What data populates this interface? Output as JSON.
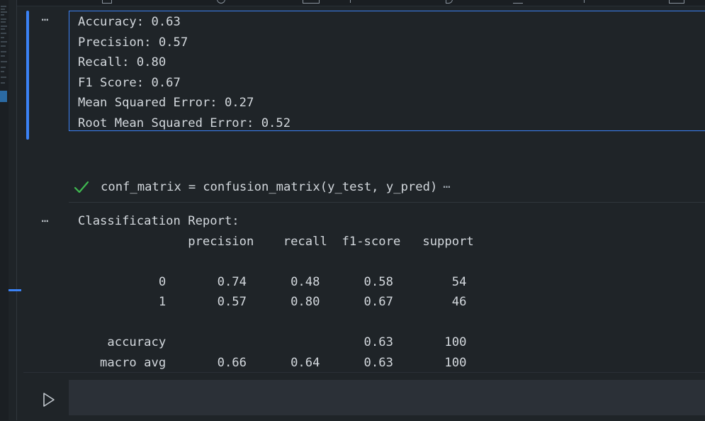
{
  "output_cell": {
    "metrics": [
      "Accuracy: 0.63",
      "Precision: 0.57",
      "Recall: 0.80",
      "F1 Score: 0.67",
      "Mean Squared Error: 0.27",
      "Root Mean Squared Error: 0.52"
    ],
    "text": "Accuracy: 0.63\nPrecision: 0.57\nRecall: 0.80\nF1 Score: 0.67\nMean Squared Error: 0.27\nRoot Mean Squared Error: 0.52"
  },
  "code_cell": {
    "var": "conf_matrix",
    "op": "=",
    "call": "confusion_matrix(y_test, y_pred)",
    "collapsed": "⋯"
  },
  "report": {
    "title": "Classification Report:",
    "header": [
      "precision",
      "recall",
      "f1-score",
      "support"
    ],
    "rows": [
      [
        "0",
        "0.74",
        "0.48",
        "0.58",
        "54"
      ],
      [
        "1",
        "0.57",
        "0.80",
        "0.67",
        "46"
      ],
      [
        "accuracy",
        "",
        "",
        "0.63",
        "100"
      ],
      [
        "macro avg",
        "0.66",
        "0.64",
        "0.63",
        "100"
      ]
    ],
    "text": "Classification Report:\n               precision    recall  f1-score   support\n\n           0       0.74      0.48      0.58        54\n           1       0.57      0.80      0.67        46\n\n    accuracy                           0.63       100\n   macro avg       0.66      0.64      0.63       100"
  },
  "ui": {
    "output_menu": "⋯",
    "accent": "#3b82f6",
    "success": "#3fb950",
    "icons": [
      "check-icon",
      "run-icon",
      "more-icon"
    ]
  }
}
